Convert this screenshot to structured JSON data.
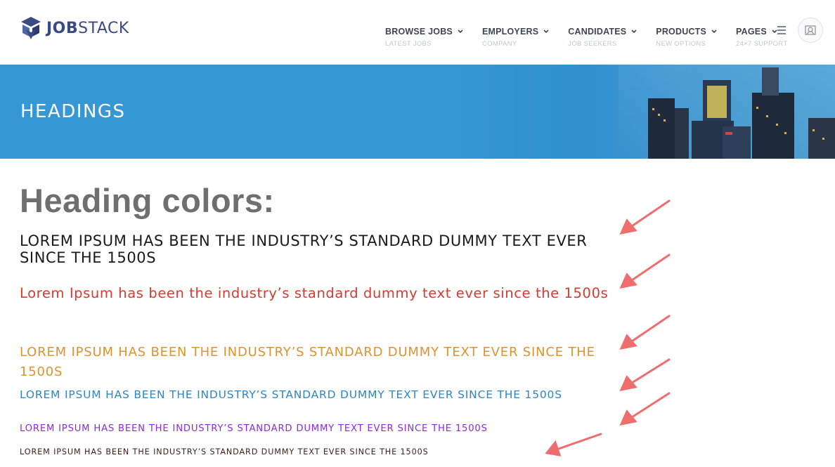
{
  "brand": {
    "name_bold": "JOB",
    "name_light": "STACK"
  },
  "nav": [
    {
      "label": "BROWSE JOBS",
      "sub": "LATEST JOBS"
    },
    {
      "label": "EMPLOYERS",
      "sub": "COMPANY"
    },
    {
      "label": "CANDIDATES",
      "sub": "JOB SEEKERS"
    },
    {
      "label": "PRODUCTS",
      "sub": "NEW OPTIONS"
    },
    {
      "label": "PAGES",
      "sub": "24×7 SUPPORT"
    }
  ],
  "banner": {
    "title": "HEADINGS"
  },
  "content": {
    "title": "Heading colors:",
    "lines": [
      {
        "text": "LOREM IPSUM HAS BEEN THE INDUSTRY’S STANDARD DUMMY TEXT EVER SINCE THE 1500S",
        "color": "#1a1a1a"
      },
      {
        "text": "Lorem Ipsum has been the industry’s standard dummy text ever since the 1500s",
        "color": "#d9392f"
      },
      {
        "text": "LOREM IPSUM HAS BEEN THE INDUSTRY’S STANDARD DUMMY TEXT EVER SINCE THE 1500S",
        "color": "#e0922d"
      },
      {
        "text": "LOREM IPSUM HAS BEEN THE INDUSTRY’S STANDARD DUMMY TEXT EVER SINCE THE 1500S",
        "color": "#2f86c4"
      },
      {
        "text": "LOREM IPSUM HAS BEEN THE INDUSTRY’S STANDARD DUMMY TEXT EVER SINCE THE 1500S",
        "color": "#8a2be2"
      },
      {
        "text": "LOREM IPSUM HAS BEEN THE INDUSTRY’S STANDARD DUMMY TEXT EVER SINCE THE 1500S",
        "color": "#3c1e16"
      }
    ]
  },
  "colors": {
    "brand": "#3b4a86",
    "banner": "#3597d3",
    "arrow": "#ee6d6d",
    "heading_gray": "#6f6f6f"
  },
  "icons": {
    "menu": "hamburger-icon",
    "user": "avatar-icon",
    "dropdown": "chevron-down-icon"
  }
}
